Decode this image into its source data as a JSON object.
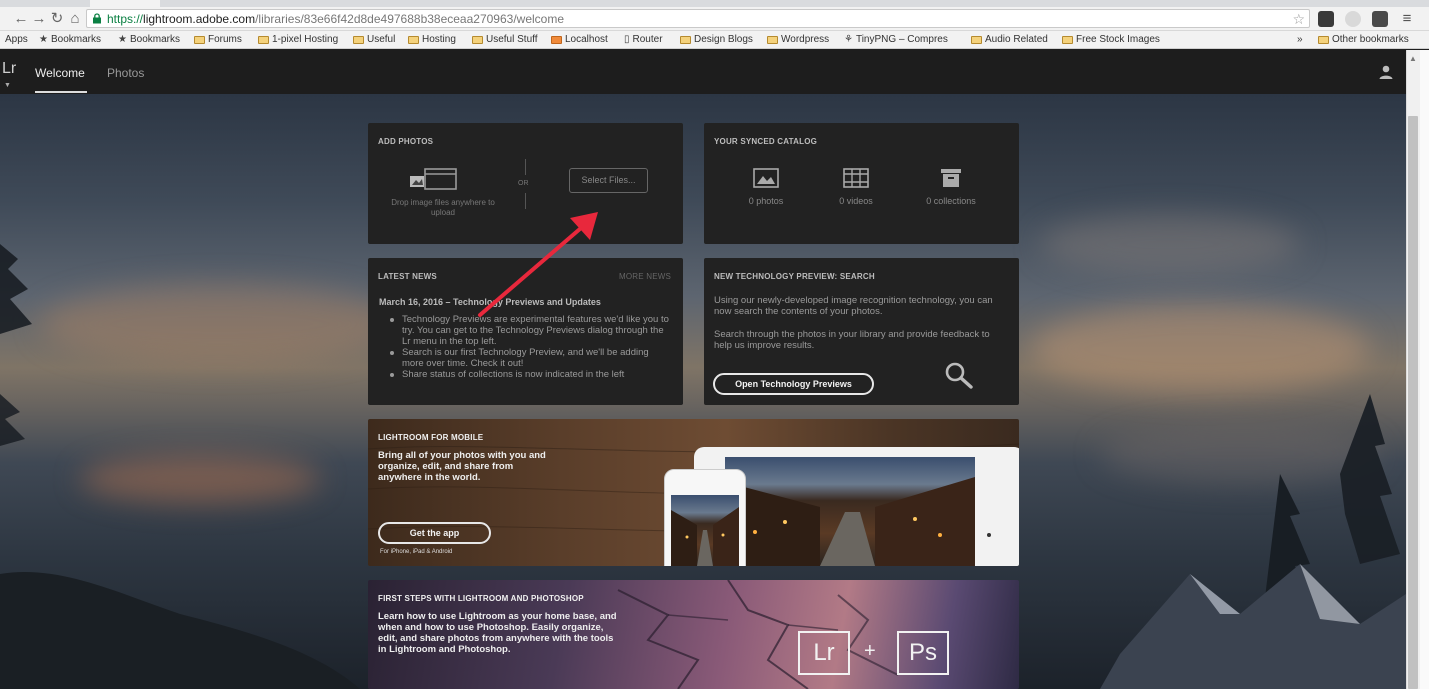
{
  "browser": {
    "url_scheme": "https://",
    "url_host": "lightroom.adobe.com",
    "url_path": "/libraries/83e66f42d8de497688b38eceaa270963/welcome",
    "bookmarks": [
      "Apps",
      "Bookmarks",
      "Bookmarks",
      "Forums",
      "1-pixel Hosting",
      "Useful",
      "Hosting",
      "Useful Stuff",
      "Localhost",
      "Router",
      "Design Blogs",
      "Wordpress",
      "TinyPNG – Compres",
      "Audio Related",
      "Free Stock Images"
    ],
    "overflow": "»",
    "other_bookmarks": "Other bookmarks"
  },
  "app": {
    "logo": "Lr",
    "tabs": [
      "Welcome",
      "Photos"
    ],
    "active_tab": "Welcome"
  },
  "add_photos": {
    "title": "ADD PHOTOS",
    "drop_hint": "Drop image files anywhere to upload",
    "or": "OR",
    "select_button": "Select Files..."
  },
  "catalog": {
    "title": "YOUR SYNCED CATALOG",
    "stats": [
      "0 photos",
      "0 videos",
      "0 collections"
    ]
  },
  "news": {
    "title": "LATEST NEWS",
    "more": "MORE NEWS",
    "headline": "March 16, 2016 – Technology Previews and Updates",
    "items": [
      "Technology Previews are experimental features we'd like you to try. You can get to the Technology Previews dialog through the Lr menu in the top left.",
      "Search is our first Technology Preview, and we'll be adding more over time. Check it out!",
      "Share status of collections is now indicated in the left"
    ]
  },
  "tech_preview": {
    "title": "NEW TECHNOLOGY PREVIEW: SEARCH",
    "para1": "Using our newly-developed image recognition technology, you can now search the contents of your photos.",
    "para2": "Search through the photos in your library and provide feedback to help us improve results.",
    "button": "Open Technology Previews"
  },
  "mobile": {
    "title": "LIGHTROOM FOR MOBILE",
    "text": "Bring all of your photos with you and organize, edit, and share from anywhere in the world.",
    "button": "Get the app",
    "for_text": "For iPhone, iPad & Android"
  },
  "first_steps": {
    "title": "FIRST STEPS WITH LIGHTROOM AND PHOTOSHOP",
    "text": "Learn how to use Lightroom as your home base, and when and how to use Photoshop. Easily organize, edit, and share photos from anywhere with the tools in Lightroom and Photoshop.",
    "lr": "Lr",
    "plus": "+",
    "ps": "Ps"
  },
  "colors": {
    "arrow": "#e8283c",
    "card_bg": "#222222",
    "url_scheme": "#0b8043"
  }
}
